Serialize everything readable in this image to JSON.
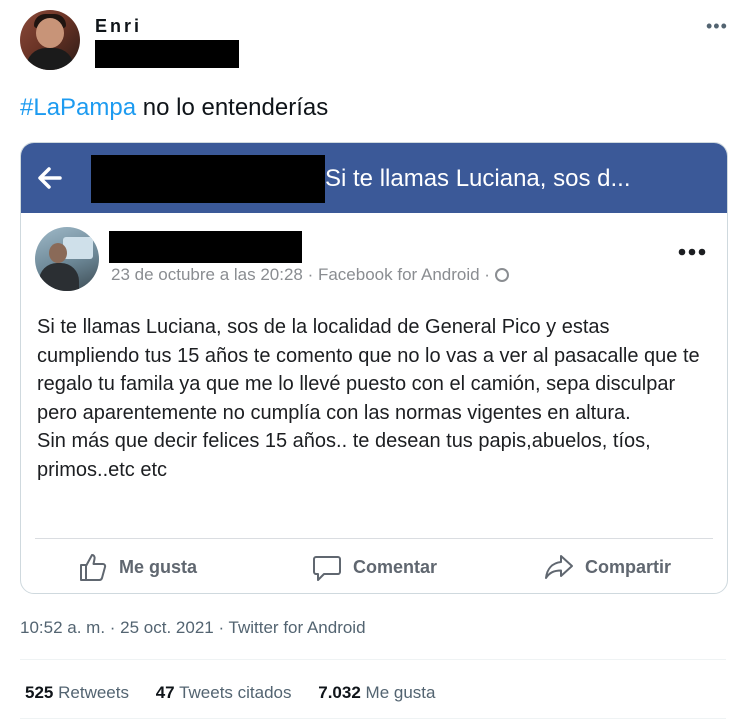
{
  "tweet": {
    "author_name": "Enri",
    "text_hashtag": "#LaPampa",
    "text_rest": " no lo entenderías",
    "timestamp": "10:52 a. m. · 25 oct. 2021 · Twitter for Android",
    "stats": {
      "retweets_value": "525",
      "retweets_label": "Retweets",
      "quotes_value": "47",
      "quotes_label": "Tweets citados",
      "likes_value": "7.032",
      "likes_label": "Me gusta"
    },
    "more_icon": "more-horizontal-icon"
  },
  "facebook_post": {
    "header_title": "Si te llamas Luciana, sos d...",
    "meta": "23 de octubre a las 20:28 · Facebook for Android · ",
    "body_line1": "Si te llamas Luciana, sos de la localidad de General Pico y estas cumpliendo tus 15 años te comento que no lo vas a ver al pasacalle que te regalo tu famila ya que me lo llevé puesto con el camión, sepa disculpar pero aparentemente no cumplía con las normas vigentes en altura.",
    "body_line2": "Sin más que decir felices 15 años.. te desean tus papis,abuelos, tíos, primos..etc etc",
    "actions": {
      "like": "Me gusta",
      "comment": "Comentar",
      "share": "Compartir"
    },
    "header_color": "#3b5998"
  },
  "colors": {
    "hashtag": "#1d9bf0",
    "muted": "#536471"
  }
}
